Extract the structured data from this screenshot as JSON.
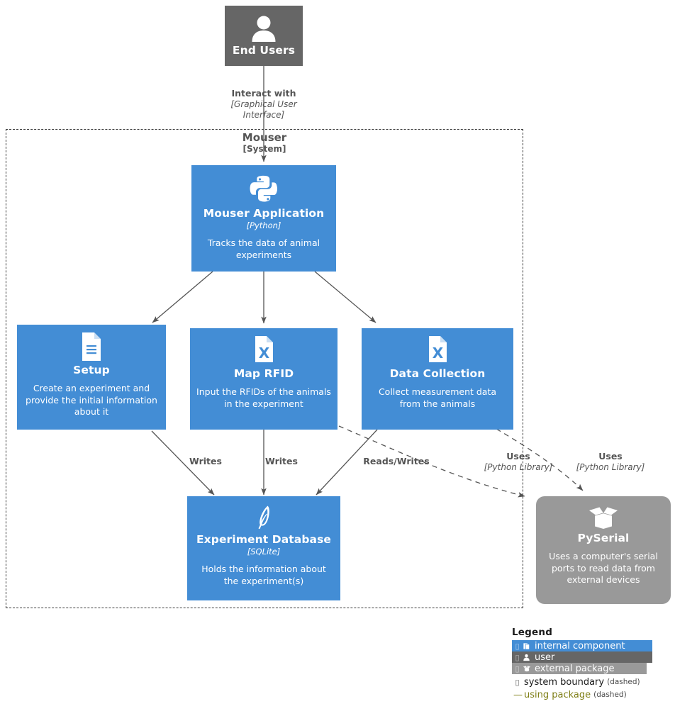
{
  "diagram": {
    "type": "C4 container diagram",
    "system_boundary": {
      "name": "Mouser",
      "type_label": "[System]"
    }
  },
  "nodes": {
    "end_users": {
      "title": "End Users",
      "icon": "person-icon",
      "kind": "user",
      "color": "#666666"
    },
    "mouser_application": {
      "title": "Mouser Application",
      "tech": "[Python]",
      "desc": "Tracks the data of animal experiments",
      "icon": "python-logo-icon",
      "kind": "internal component",
      "color": "#438dd5"
    },
    "setup": {
      "title": "Setup",
      "desc": "Create an experiment and provide the initial information about it",
      "icon": "document-lines-icon",
      "kind": "internal component",
      "color": "#438dd5"
    },
    "map_rfid": {
      "title": "Map RFID",
      "desc": "Input the RFIDs of the animals in the experiment",
      "icon": "excel-file-icon",
      "kind": "internal component",
      "color": "#438dd5"
    },
    "data_collection": {
      "title": "Data Collection",
      "desc": "Collect measurement data from the animals",
      "icon": "excel-file-icon",
      "kind": "internal component",
      "color": "#438dd5"
    },
    "experiment_database": {
      "title": "Experiment Database",
      "tech": "[SQLite]",
      "desc": "Holds the information about the experiment(s)",
      "icon": "sqlite-feather-icon",
      "kind": "internal component",
      "color": "#438dd5"
    },
    "pyserial": {
      "title": "PySerial",
      "desc": "Uses a computer's serial ports to read data from external devices",
      "icon": "package-box-icon",
      "kind": "external package",
      "color": "#999999"
    }
  },
  "edges": {
    "interact_with": {
      "main": "Interact with",
      "sub": "[Graphical User Interface]"
    },
    "writes_setup": {
      "main": "Writes",
      "sub": ""
    },
    "writes_rfid": {
      "main": "Writes",
      "sub": ""
    },
    "reads_writes": {
      "main": "Reads/Writes",
      "sub": ""
    },
    "uses_rfid": {
      "main": "Uses",
      "sub": "[Python Library]"
    },
    "uses_collection": {
      "main": "Uses",
      "sub": "[Python Library]"
    }
  },
  "legend": {
    "title": "Legend",
    "rows": [
      {
        "label": "internal component",
        "icon": "component-icon",
        "swatch": "#438dd5",
        "note": ""
      },
      {
        "label": "user",
        "icon": "person-icon",
        "swatch": "#666666",
        "note": ""
      },
      {
        "label": "external package",
        "icon": "package-box-icon",
        "swatch": "#999999",
        "note": ""
      },
      {
        "label": "system boundary",
        "icon": "dashed-rect-icon",
        "swatch": "",
        "note": "(dashed)"
      },
      {
        "label": "using package",
        "icon": "dashed-line-icon",
        "swatch": "",
        "note": "(dashed)"
      }
    ]
  }
}
